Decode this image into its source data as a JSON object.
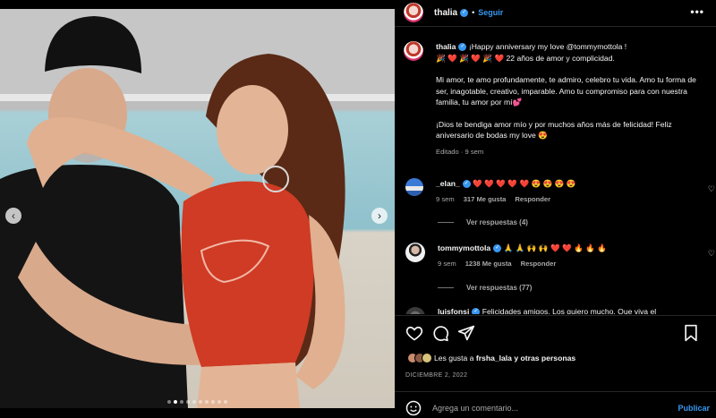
{
  "post": {
    "username": "thalia",
    "follow_label": "Seguir",
    "more_label": "•••",
    "carousel": {
      "slides": 10,
      "active_index": 1
    }
  },
  "caption": {
    "username": "thalia",
    "line1": " ¡Happy anniversary my love @tommymottola !",
    "line2": "🎉 ❤️ 🎉 ❤️ 🎉 ❤️ 22 años de amor y complicidad.",
    "para2": "Mi amor, te amo profundamente, te admiro, celebro tu vida. Amo tu forma de ser, inagotable, creativo, imparable. Amo tu compromiso para con nuestra familia, tu amor por mí💕",
    "para3": "¡Dios te bendiga amor mío y por muchos años más de felicidad! Feliz aniversario de bodas my love 😍",
    "meta": "Editado · 9 sem"
  },
  "comments": [
    {
      "username": "_elan_",
      "text": " ❤️ ❤️ ❤️ ❤️ ❤️ 😍 😍 😍 😍",
      "time": "9 sem",
      "likes": "317 Me gusta",
      "reply_label": "Responder",
      "view_replies": "Ver respuestas (4)"
    },
    {
      "username": "tommymottola",
      "text": " 🙏 🙏 🙌 🙌 ❤️ ❤️ 🔥 🔥 🔥",
      "time": "9 sem",
      "likes": "1238 Me gusta",
      "reply_label": "Responder",
      "view_replies": "Ver respuestas (77)"
    },
    {
      "username": "luisfonsi",
      "text": " Felicidades amigos. Los quiero mucho. Que viva el"
    }
  ],
  "likes": {
    "prefix": "Les gusta a ",
    "user": "frsha_lala",
    "suffix": " y otras personas"
  },
  "date": "DICIEMBRE 2, 2022",
  "composer": {
    "placeholder": "Agrega un comentario...",
    "post_label": "Publicar"
  },
  "colors": {
    "background": "#000000",
    "link_blue": "#3897f0",
    "secondary_text": "#a8a8a8"
  },
  "icons": [
    "heart-icon",
    "comment-icon",
    "share-icon",
    "bookmark-icon",
    "emoji-icon",
    "verified-icon",
    "more-icon"
  ]
}
